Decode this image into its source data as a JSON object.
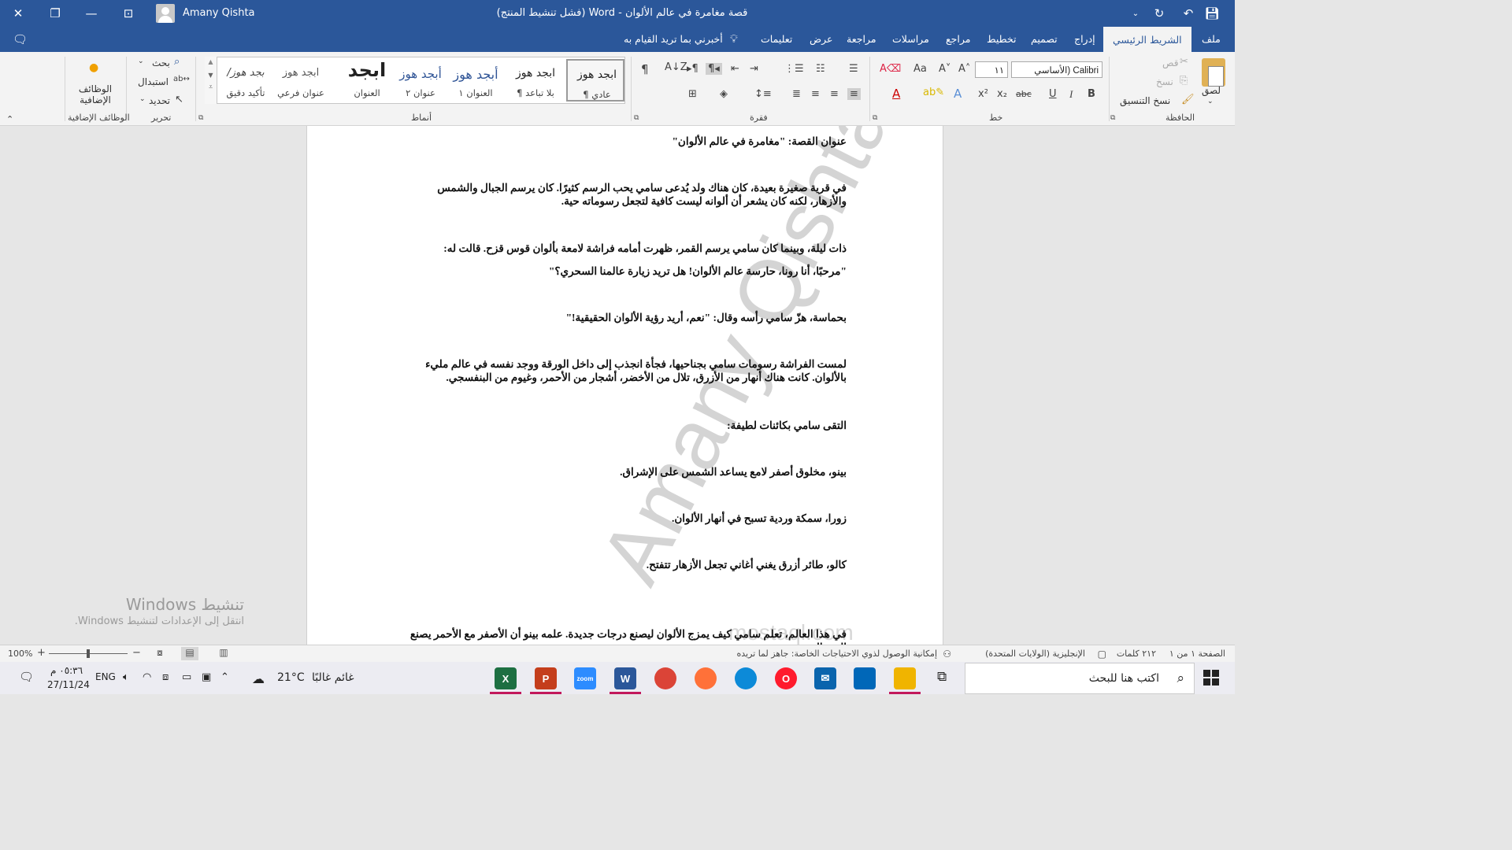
{
  "window": {
    "title": "قصة مغامرة في عالم الألوان  -  Word (فشل تنشيط المنتج)",
    "user_name": "Amany Qishta"
  },
  "tabs": [
    {
      "id": "file",
      "label": "ملف"
    },
    {
      "id": "home",
      "label": "الشريط الرئيسي"
    },
    {
      "id": "insert",
      "label": "إدراج"
    },
    {
      "id": "design",
      "label": "تصميم"
    },
    {
      "id": "layout",
      "label": "تخطيط"
    },
    {
      "id": "references",
      "label": "مراجع"
    },
    {
      "id": "mailings",
      "label": "مراسلات"
    },
    {
      "id": "review",
      "label": "مراجعة"
    },
    {
      "id": "view",
      "label": "عرض"
    },
    {
      "id": "help",
      "label": "تعليمات"
    }
  ],
  "tell_me": "أخبرني بما تريد القيام به",
  "ribbon": {
    "clipboard": {
      "group_label": "الحافظة",
      "paste": "لصق",
      "cut": "قص",
      "copy": "نسخ",
      "format_painter": "نسخ التنسيق"
    },
    "font": {
      "group_label": "خط",
      "font_name": "Calibri (الأساسي",
      "font_size": "١١"
    },
    "paragraph": {
      "group_label": "فقرة"
    },
    "styles": {
      "group_label": "أنماط",
      "items": [
        {
          "preview": "ابجد هوز",
          "name": "¶ عادي"
        },
        {
          "preview": "ابجد هوز",
          "name": "¶ بلا تباعد"
        },
        {
          "preview": "أبجد هوز",
          "name": "العنوان ١"
        },
        {
          "preview": "أبجد هوز",
          "name": "عنوان ٢"
        },
        {
          "preview": "ابجد",
          "name": "العنوان"
        },
        {
          "preview": "ابجد هوز",
          "name": "عنوان فرعي"
        },
        {
          "preview": "/بجد هوز",
          "name": "تأكيد دقيق"
        }
      ]
    },
    "editing": {
      "group_label": "تحرير",
      "find": "بحث",
      "replace": "استبدال",
      "select": "تحديد"
    },
    "addins": {
      "group_label": "الوظائف الإضافية",
      "button": "الوظائف الإضافية"
    }
  },
  "document": {
    "paragraphs": [
      "عنوان القصة: \"مغامرة في عالم الألوان\"",
      "في قرية صغيرة بعيدة، كان هناك ولد يُدعى سامي يحب الرسم كثيرًا. كان يرسم الجبال والشمس والأزهار، لكنه كان يشعر أن ألوانه ليست كافية لتجعل رسوماته حية.",
      "ذات ليلة، وبينما كان سامي يرسم القمر، ظهرت أمامه فراشة لامعة بألوان قوس قزح. قالت له:",
      "\"مرحبًا، أنا رونا، حارسة عالم الألوان! هل تريد زيارة عالمنا السحري؟\"",
      "بحماسة، هزّ سامي رأسه وقال: \"نعم، أريد رؤية الألوان الحقيقية!\"",
      "لمست الفراشة رسومات سامي بجناحيها، فجأة انجذب إلى داخل الورقة ووجد نفسه في عالم مليء بالألوان. كانت هناك أنهار من الأزرق، تلال من الأخضر، أشجار من الأحمر، وغيوم من البنفسجي.",
      "التقى سامي بكائنات لطيفة:",
      "بينو، مخلوق أصفر لامع يساعد الشمس على الإشراق.",
      "زورا، سمكة وردية تسبح في أنهار الألوان.",
      "كالو، طائر أزرق يغني أغاني تجعل الأزهار تتفتح.",
      "في هذا العالم، تعلم سامي كيف يمزج الألوان ليصنع درجات جديدة. علمه بينو أن الأصفر مع الأحمر يصنع البرتقالي،"
    ],
    "watermark": "Amany Qishta",
    "watermark_sub": "mostaql.com"
  },
  "activation": {
    "title": "تنشيط Windows",
    "subtitle": "انتقل إلى الإعدادات لتنشيط Windows."
  },
  "statusbar": {
    "page": "الصفحة ١ من ١",
    "words": "٢١٢ كلمات",
    "language": "الإنجليزية (الولايات المتحدة)",
    "accessibility": "إمكانية الوصول لذوي الاحتياجات الخاصة: جاهز لما تريده",
    "zoom": "100%",
    "zoom_level": 0.5
  },
  "taskbar": {
    "search_placeholder": "اكتب هنا للبحث",
    "weather_temp": "21°C",
    "weather_desc": "غائم غالبًا",
    "language": "ENG",
    "time": "٠٥:٣٦ م",
    "date": "27/11/24",
    "apps": [
      {
        "name": "excel",
        "letter": "X",
        "color": "#1d6f42"
      },
      {
        "name": "powerpoint",
        "letter": "P",
        "color": "#c43e1c"
      },
      {
        "name": "zoom",
        "letter": "zoom",
        "color": "#2d8cff"
      },
      {
        "name": "word",
        "letter": "W",
        "color": "#2b579a"
      },
      {
        "name": "chrome",
        "letter": "",
        "color": "#db4437"
      },
      {
        "name": "firefox",
        "letter": "",
        "color": "#ff7139"
      },
      {
        "name": "edge",
        "letter": "",
        "color": "#0c8ad8"
      },
      {
        "name": "opera",
        "letter": "O",
        "color": "#ff1b2d"
      },
      {
        "name": "mail",
        "letter": "✉",
        "color": "#0a64ad"
      },
      {
        "name": "store",
        "letter": "",
        "color": "#0067b8"
      },
      {
        "name": "file-explorer",
        "letter": "",
        "color": "#f0b400"
      }
    ]
  },
  "colors": {
    "accent": "#2b579a",
    "ribbon_bg": "#f3f3f3",
    "canvas_bg": "#e6e6e6"
  }
}
